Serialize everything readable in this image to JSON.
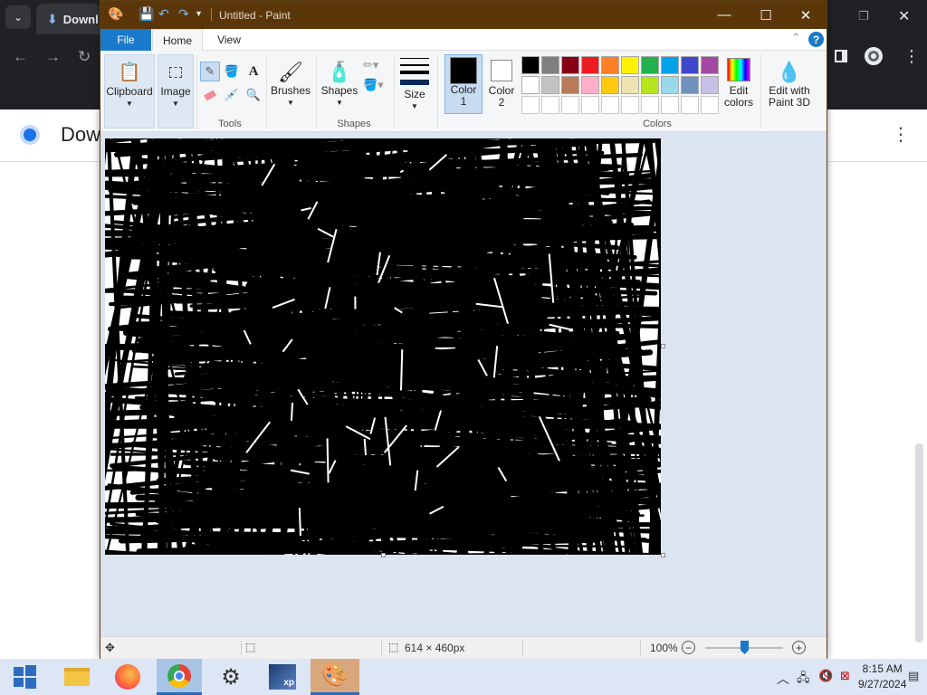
{
  "chrome": {
    "tab_title": "Downl",
    "page_title": "Dow",
    "kebab": "⋮"
  },
  "paint": {
    "window_title": "Untitled - Paint",
    "tabs": [
      "File",
      "Home",
      "View"
    ],
    "help": "?",
    "clipboard": {
      "label": "Clipboard"
    },
    "image": {
      "label": "Image"
    },
    "tools": {
      "group_label": "Tools"
    },
    "brushes": {
      "label": "Brushes"
    },
    "shapes": {
      "label": "Shapes",
      "group_label": "Shapes"
    },
    "size": {
      "label": "Size"
    },
    "color1": {
      "label_line1": "Color",
      "label_line2": "1",
      "value": "#000000"
    },
    "color2": {
      "label_line1": "Color",
      "label_line2": "2",
      "value": "#ffffff"
    },
    "colors": {
      "group_label": "Colors"
    },
    "edit_colors": {
      "line1": "Edit",
      "line2": "colors"
    },
    "edit_paint3d": {
      "line1": "Edit with",
      "line2": "Paint 3D"
    },
    "palette_row1": [
      "#000000",
      "#7f7f7f",
      "#880015",
      "#ed1c24",
      "#ff7f27",
      "#fff200",
      "#22b14c",
      "#00a2e8",
      "#3f48cc",
      "#a349a4"
    ],
    "palette_row2": [
      "#ffffff",
      "#c3c3c3",
      "#b97a57",
      "#ffaec9",
      "#ffc90e",
      "#efe4b0",
      "#b5e61d",
      "#99d9ea",
      "#7092be",
      "#c8bfe7"
    ],
    "status": {
      "dimensions": "614 × 460px",
      "zoom": "100%",
      "zoom_level": 1.0
    }
  },
  "taskbar": {
    "time": "8:15 AM",
    "date": "9/27/2024"
  }
}
